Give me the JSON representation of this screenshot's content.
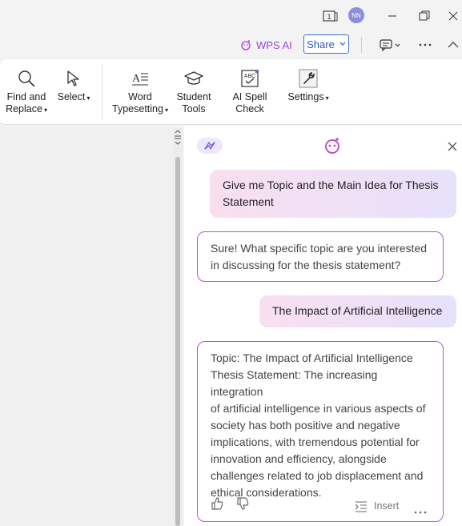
{
  "titlebar": {
    "avatar_initials": "NN",
    "icons": [
      "window-count-icon",
      "minimize-icon",
      "restore-icon",
      "close-icon"
    ],
    "window_count": "1"
  },
  "toolbar": {
    "wps_ai_label": "WPS AI",
    "share_label": "Share"
  },
  "ribbon": {
    "find_replace_line1": "Find and",
    "find_replace_line2": "Replace",
    "select_label": "Select",
    "word_typesetting_line1": "Word",
    "word_typesetting_line2": "Typesetting",
    "student_tools_line1": "Student",
    "student_tools_line2": "Tools",
    "ai_spell_check_label": "AI Spell Check",
    "settings_label": "Settings"
  },
  "chat": {
    "messages": [
      {
        "role": "user",
        "text_line1": "Give me Topic and the Main Idea for Thesis",
        "text_line2": "Statement"
      },
      {
        "role": "ai",
        "text_line1": "Sure! What specific topic are you interested",
        "text_line2": "in discussing for the thesis statement?"
      },
      {
        "role": "user",
        "text_line1": "The Impact of Artificial Intelligence"
      },
      {
        "role": "ai",
        "lines": [
          "Topic: The Impact of Artificial Intelligence",
          "Thesis Statement: The increasing integration",
          "of artificial intelligence in various aspects of",
          "society has both positive and negative",
          "implications, with tremendous potential for",
          "innovation and efficiency, alongside",
          "challenges related to job displacement and",
          "ethical considerations."
        ]
      }
    ],
    "insert_label": "Insert"
  },
  "colors": {
    "accent_purple": "#b157cf",
    "share_blue": "#3c6fd6"
  }
}
